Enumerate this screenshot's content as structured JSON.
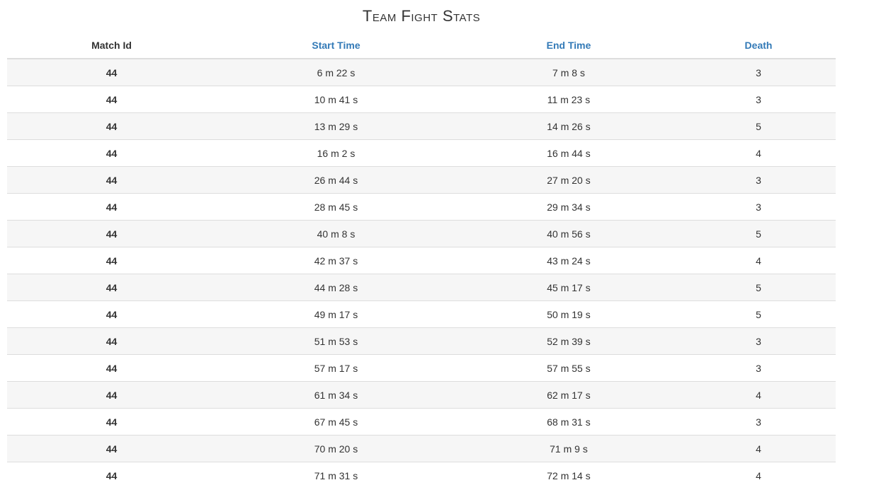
{
  "title": "Team Fight Stats",
  "table": {
    "headers": {
      "match_id": "Match Id",
      "start_time": "Start Time",
      "end_time": "End Time",
      "death": "Death"
    },
    "rows": [
      {
        "match_id": "44",
        "start_time": "6 m 22 s",
        "end_time": "7 m 8 s",
        "death": "3"
      },
      {
        "match_id": "44",
        "start_time": "10 m 41 s",
        "end_time": "11 m 23 s",
        "death": "3"
      },
      {
        "match_id": "44",
        "start_time": "13 m 29 s",
        "end_time": "14 m 26 s",
        "death": "5"
      },
      {
        "match_id": "44",
        "start_time": "16 m 2 s",
        "end_time": "16 m 44 s",
        "death": "4"
      },
      {
        "match_id": "44",
        "start_time": "26 m 44 s",
        "end_time": "27 m 20 s",
        "death": "3"
      },
      {
        "match_id": "44",
        "start_time": "28 m 45 s",
        "end_time": "29 m 34 s",
        "death": "3"
      },
      {
        "match_id": "44",
        "start_time": "40 m 8 s",
        "end_time": "40 m 56 s",
        "death": "5"
      },
      {
        "match_id": "44",
        "start_time": "42 m 37 s",
        "end_time": "43 m 24 s",
        "death": "4"
      },
      {
        "match_id": "44",
        "start_time": "44 m 28 s",
        "end_time": "45 m 17 s",
        "death": "5"
      },
      {
        "match_id": "44",
        "start_time": "49 m 17 s",
        "end_time": "50 m 19 s",
        "death": "5"
      },
      {
        "match_id": "44",
        "start_time": "51 m 53 s",
        "end_time": "52 m 39 s",
        "death": "3"
      },
      {
        "match_id": "44",
        "start_time": "57 m 17 s",
        "end_time": "57 m 55 s",
        "death": "3"
      },
      {
        "match_id": "44",
        "start_time": "61 m 34 s",
        "end_time": "62 m 17 s",
        "death": "4"
      },
      {
        "match_id": "44",
        "start_time": "67 m 45 s",
        "end_time": "68 m 31 s",
        "death": "3"
      },
      {
        "match_id": "44",
        "start_time": "70 m 20 s",
        "end_time": "71 m 9 s",
        "death": "4"
      },
      {
        "match_id": "44",
        "start_time": "71 m 31 s",
        "end_time": "72 m 14 s",
        "death": "4"
      }
    ]
  },
  "colors": {
    "link": "#337ab7",
    "stripe": "#f6f6f6",
    "border": "#dddddd",
    "text": "#333333"
  }
}
